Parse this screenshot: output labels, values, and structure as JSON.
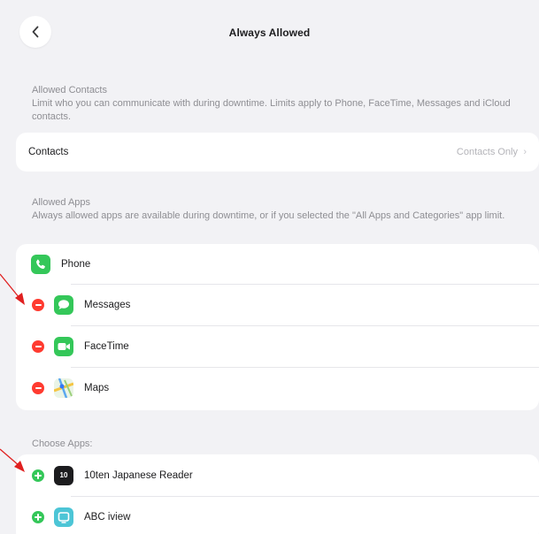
{
  "nav": {
    "title": "Always Allowed",
    "back_icon": "chevron-left-icon"
  },
  "allowed_contacts": {
    "header": "Allowed Contacts",
    "description": "Limit who you can communicate with during downtime. Limits apply to Phone, FaceTime, Messages and iCloud contacts.",
    "row_label": "Contacts",
    "row_value": "Contacts Only"
  },
  "allowed_apps": {
    "header": "Allowed Apps",
    "description": "Always allowed apps are available during downtime, or if you selected the \"All Apps and Categories\" app limit.",
    "items": [
      {
        "label": "Phone",
        "icon": "phone-icon",
        "control": "none"
      },
      {
        "label": "Messages",
        "icon": "messages-icon",
        "control": "remove"
      },
      {
        "label": "FaceTime",
        "icon": "facetime-icon",
        "control": "remove"
      },
      {
        "label": "Maps",
        "icon": "maps-icon",
        "control": "remove"
      }
    ]
  },
  "choose_apps": {
    "header": "Choose Apps:",
    "items": [
      {
        "label": "10ten Japanese Reader",
        "icon": "10ten-app-icon",
        "icon_text": "10",
        "control": "add"
      },
      {
        "label": "ABC iview",
        "icon": "abc-iview-icon",
        "control": "add"
      }
    ]
  },
  "colors": {
    "background": "#f2f2f5",
    "card": "#ffffff",
    "remove": "#ff3b30",
    "add": "#34c759",
    "annotation_arrow": "#e02020",
    "secondary_text": "#8e8e93"
  }
}
